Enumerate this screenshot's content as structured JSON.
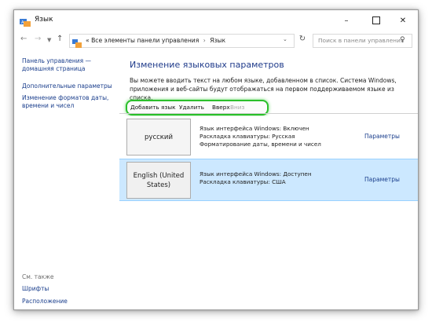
{
  "window": {
    "title": "Язык"
  },
  "address": {
    "prefix": "«",
    "crumbs": [
      "Все элементы панели управления",
      "Язык"
    ],
    "search_placeholder": "Поиск в панели управления"
  },
  "sidebar": {
    "home": "Панель управления — домашняя страница",
    "advanced": "Дополнительные параметры",
    "formats": "Изменение форматов даты, времени и чисел",
    "see_also": "См. также",
    "fonts": "Шрифты",
    "location": "Расположение"
  },
  "main": {
    "title": "Изменение языковых параметров",
    "description": "Вы можете вводить текст на любом языке, добавленном в список. Система Windows, приложения и веб-сайты будут отображаться на первом поддерживаемом языке из списка.",
    "toolbar": {
      "add": "Добавить язык",
      "remove": "Удалить",
      "up": "Вверх",
      "down": "Вниз"
    },
    "languages": [
      {
        "name": "русский",
        "info": [
          "Язык интерфейса Windows: Включен",
          "Раскладка клавиатуры: Русская",
          "Форматирование даты, времени и чисел"
        ],
        "options": "Параметры"
      },
      {
        "name": "English (United States)",
        "info": [
          "Язык интерфейса Windows: Доступен",
          "Раскладка клавиатуры: США"
        ],
        "options": "Параметры"
      }
    ]
  },
  "colors": {
    "link": "#1a3e8c",
    "highlight": "#2bbf2b",
    "selected_row": "#cce8ff"
  }
}
